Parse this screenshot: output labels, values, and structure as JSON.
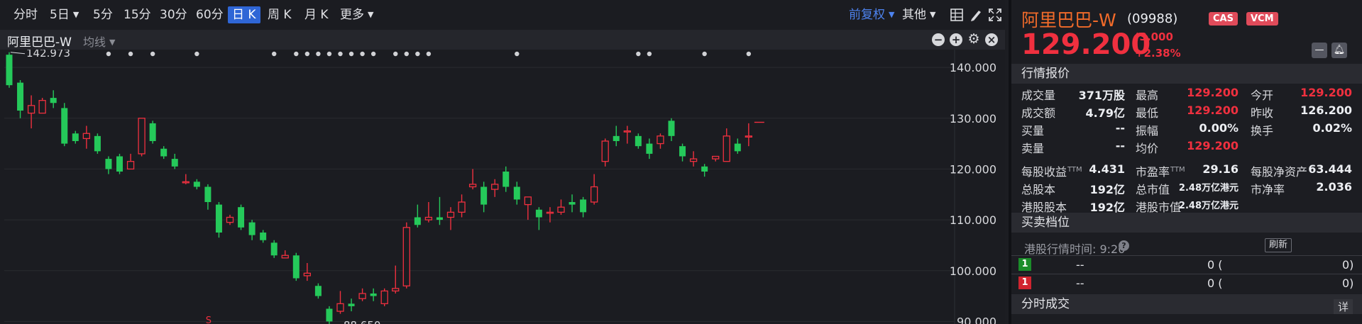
{
  "toolbar": {
    "periods": [
      "分时",
      "5日",
      "5分",
      "15分",
      "30分",
      "60分",
      "日 K",
      "周 K",
      "月 K",
      "更多"
    ],
    "active_period": "日 K",
    "adjust": "前复权",
    "other": "其他",
    "icons": [
      "grid-icon",
      "draw-pen-icon",
      "fullscreen-icon"
    ]
  },
  "chart_head": {
    "stock": "阿里巴巴-W",
    "indicator": "均线",
    "buttons": [
      "minus-circle-icon",
      "plus-circle-icon",
      "gear-icon",
      "close-circle-icon"
    ]
  },
  "chart_data": {
    "type": "candlestick",
    "ylim": [
      89.5,
      143.5
    ],
    "yticks": [
      "140.000",
      "130.000",
      "120.000",
      "110.000",
      "100.000",
      "90.000"
    ],
    "annotations": {
      "high": "142.973",
      "low": "88.650",
      "marker": "S"
    },
    "up_color": "#f0303f",
    "down_color": "#25c95a",
    "last_price_line": 129.2,
    "candles": [
      [
        142.5,
        136.5,
        143.0,
        136.0
      ],
      [
        137.0,
        131.5,
        137.5,
        130.0
      ],
      [
        131.0,
        132.5,
        134.5,
        128.0
      ],
      [
        131.0,
        133.5,
        134.0,
        131.0
      ],
      [
        134.0,
        133.0,
        135.5,
        132.0
      ],
      [
        132.0,
        125.0,
        133.0,
        124.5
      ],
      [
        127.0,
        125.5,
        127.5,
        125.0
      ],
      [
        126.0,
        127.0,
        128.5,
        124.0
      ],
      [
        126.5,
        123.5,
        127.0,
        123.0
      ],
      [
        122.0,
        120.0,
        122.5,
        119.0
      ],
      [
        122.5,
        119.5,
        123.0,
        119.0
      ],
      [
        120.0,
        121.5,
        123.0,
        120.0
      ],
      [
        123.0,
        130.0,
        130.0,
        122.5
      ],
      [
        129.0,
        125.5,
        129.5,
        125.0
      ],
      [
        124.0,
        122.5,
        124.5,
        122.0
      ],
      [
        122.0,
        120.5,
        123.0,
        120.0
      ],
      [
        117.5,
        117.5,
        119.0,
        117.0
      ],
      [
        117.5,
        116.5,
        118.0,
        116.0
      ],
      [
        116.5,
        113.5,
        117.0,
        112.0
      ],
      [
        113.0,
        107.5,
        113.5,
        106.5
      ],
      [
        109.5,
        110.5,
        111.0,
        109.0
      ],
      [
        112.5,
        108.5,
        113.0,
        108.0
      ],
      [
        109.5,
        107.0,
        110.0,
        106.0
      ],
      [
        107.5,
        106.0,
        108.0,
        105.5
      ],
      [
        105.5,
        103.0,
        106.0,
        102.5
      ],
      [
        102.5,
        103.0,
        104.0,
        102.5
      ],
      [
        103.0,
        98.5,
        103.5,
        98.0
      ],
      [
        99.0,
        99.5,
        101.5,
        98.0
      ],
      [
        97.0,
        95.0,
        97.5,
        94.5
      ],
      [
        92.5,
        90.0,
        93.0,
        88.65
      ],
      [
        92.0,
        93.5,
        96.0,
        91.5
      ],
      [
        93.5,
        93.0,
        94.5,
        92.0
      ],
      [
        94.5,
        95.5,
        96.5,
        94.0
      ],
      [
        95.5,
        95.0,
        96.5,
        94.0
      ],
      [
        93.5,
        96.0,
        96.5,
        93.0
      ],
      [
        96.0,
        96.5,
        101.0,
        95.5
      ],
      [
        97.0,
        108.5,
        109.5,
        96.5
      ],
      [
        110.5,
        109.0,
        113.0,
        108.5
      ],
      [
        110.0,
        110.5,
        113.5,
        109.5
      ],
      [
        110.5,
        110.0,
        114.5,
        109.0
      ],
      [
        110.5,
        111.5,
        112.5,
        108.0
      ],
      [
        111.5,
        113.5,
        115.0,
        110.5
      ],
      [
        116.5,
        117.0,
        120.0,
        116.0
      ],
      [
        116.5,
        113.0,
        117.5,
        111.5
      ],
      [
        116.0,
        117.0,
        118.0,
        114.5
      ],
      [
        119.5,
        116.5,
        120.5,
        115.5
      ],
      [
        116.5,
        114.0,
        117.5,
        113.0
      ],
      [
        113.0,
        114.5,
        114.5,
        110.0
      ],
      [
        112.0,
        110.5,
        112.5,
        108.0
      ],
      [
        111.5,
        111.5,
        112.5,
        109.5
      ],
      [
        111.5,
        112.5,
        114.0,
        111.0
      ],
      [
        113.5,
        113.0,
        115.0,
        111.5
      ],
      [
        114.0,
        111.5,
        114.5,
        110.5
      ],
      [
        113.5,
        116.5,
        119.0,
        113.0
      ],
      [
        121.5,
        125.5,
        126.0,
        120.5
      ],
      [
        126.5,
        125.5,
        128.5,
        124.5
      ],
      [
        127.5,
        127.5,
        128.5,
        125.0
      ],
      [
        126.5,
        124.5,
        127.0,
        124.0
      ],
      [
        125.0,
        123.0,
        126.0,
        122.0
      ],
      [
        125.0,
        126.5,
        127.0,
        124.0
      ],
      [
        129.5,
        126.5,
        130.0,
        125.5
      ],
      [
        124.5,
        122.5,
        125.0,
        121.5
      ],
      [
        121.5,
        122.0,
        123.5,
        120.5
      ],
      [
        120.5,
        119.5,
        121.0,
        118.5
      ],
      [
        122.0,
        122.5,
        122.5,
        121.5
      ],
      [
        121.5,
        126.5,
        128.0,
        121.5
      ],
      [
        125.0,
        123.5,
        126.0,
        123.0
      ],
      [
        126.5,
        126.5,
        129.0,
        124.5
      ]
    ]
  },
  "quote": {
    "name": "阿里巴巴-W",
    "code": "(09988)",
    "badges": [
      "CAS",
      "VCM"
    ],
    "price": "129.200",
    "change": "3.000",
    "change_pct": "+2.38%",
    "section_quote": "行情报价",
    "rows": [
      [
        [
          "成交量",
          "371万股"
        ],
        [
          "最高",
          "129.200"
        ],
        [
          "今开",
          "129.200"
        ]
      ],
      [
        [
          "成交额",
          "4.79亿"
        ],
        [
          "最低",
          "129.200"
        ],
        [
          "昨收",
          "126.200"
        ]
      ],
      [
        [
          "买量",
          "--"
        ],
        [
          "振幅",
          "0.00%"
        ],
        [
          "换手",
          "0.02%"
        ]
      ],
      [
        [
          "卖量",
          "--"
        ],
        [
          "均价",
          "129.200"
        ],
        [
          "",
          ""
        ]
      ],
      [
        [
          "每股收益",
          "4.431"
        ],
        [
          "市盈率",
          "29.16"
        ],
        [
          "每股净资产",
          "63.444"
        ]
      ],
      [
        [
          "总股本",
          "192亿"
        ],
        [
          "总市值",
          "2.48万亿港元"
        ],
        [
          "市净率",
          "2.036"
        ]
      ],
      [
        [
          "港股股本",
          "192亿"
        ],
        [
          "港股市值",
          "2.48万亿港元"
        ],
        [
          "",
          ""
        ]
      ]
    ],
    "ttm": "TTM",
    "section_orderbook": "买卖档位",
    "orderbook_time": "港股行情时间: 9:20",
    "refresh": "刷新",
    "orderbook": [
      {
        "level": "1",
        "price": "--",
        "qty": "0 (",
        "close": "0)"
      },
      {
        "level": "1",
        "price": "--",
        "qty": "0 (",
        "close": "0)"
      }
    ],
    "section_trades": "分时成交",
    "detail": "详"
  }
}
